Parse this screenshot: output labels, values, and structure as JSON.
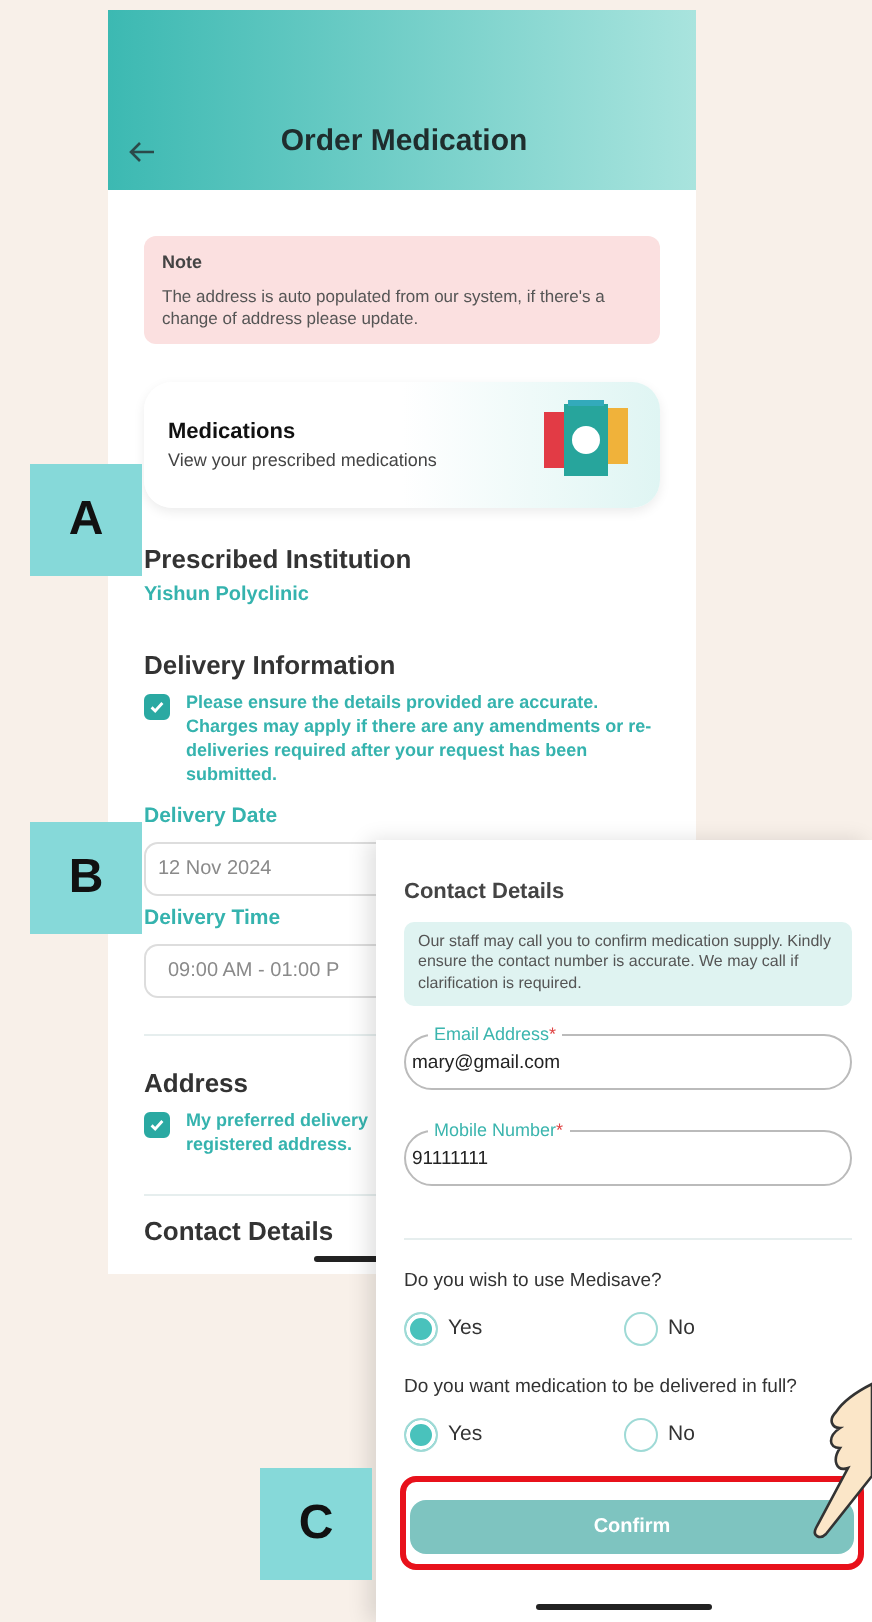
{
  "step_labels": [
    {
      "text": "A"
    },
    {
      "text": "B"
    },
    {
      "text": "C"
    }
  ],
  "screen_1": {
    "header": {
      "title": "Order Medication"
    },
    "note": {
      "title": "Note",
      "text": "The address is auto populated from our system, if there's a change of address please update."
    },
    "medications_card": {
      "title": "Medications",
      "subtitle": "View your prescribed medications"
    },
    "prescribed_institution": {
      "heading": "Prescribed Institution",
      "value": "Yishun Polyclinic"
    },
    "delivery_information": {
      "heading": "Delivery Information",
      "acknowledgement": {
        "checked": true,
        "text": "Please ensure the details provided are accurate. Charges may apply if there are any amendments or re-deliveries required after your request has been submitted."
      },
      "date": {
        "label": "Delivery Date",
        "value": "12 Nov 2024"
      },
      "time": {
        "label": "Delivery Time",
        "value": "09:00 AM - 01:00 P"
      }
    },
    "address": {
      "heading": "Address",
      "preference": {
        "checked": true,
        "text": "My preferred delivery registered address."
      }
    },
    "next_heading": "Contact Details"
  },
  "screen_2": {
    "heading": "Contact Details",
    "info": "Our staff may call you to confirm medication supply. Kindly ensure the contact number is accurate. We may call if clarification is required.",
    "fields": [
      {
        "label": "Email Address",
        "required_mark": "*",
        "value": "mary@gmail.com"
      },
      {
        "label": "Mobile Number",
        "required_mark": "*",
        "value": "91111111"
      }
    ],
    "questions": [
      {
        "text": "Do you wish to use Medisave?",
        "options": [
          {
            "label": "Yes",
            "selected": true
          },
          {
            "label": "No",
            "selected": false
          }
        ]
      },
      {
        "text": "Do you want medication to be delivered in full?",
        "options": [
          {
            "label": "Yes",
            "selected": true
          },
          {
            "label": "No",
            "selected": false
          }
        ]
      }
    ],
    "confirm_button": {
      "label": "Confirm",
      "highlighted": true
    }
  }
}
